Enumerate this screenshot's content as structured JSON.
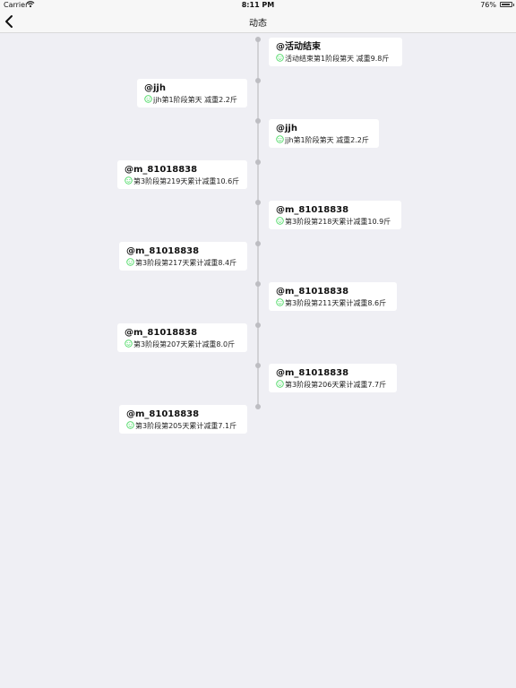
{
  "status_bar": {
    "carrier": "Carrier",
    "time": "8:11 PM",
    "battery": "76%"
  },
  "nav": {
    "title": "动态",
    "back_icon": "chevron-left-icon"
  },
  "accent_color": "#4cd964",
  "feed": [
    {
      "side": "right",
      "name": "@活动结束",
      "detail": "活动结束第1阶段第天 减重9.8斤"
    },
    {
      "side": "left",
      "name": "@jjh",
      "detail": "jjh第1阶段第天 减重2.2斤"
    },
    {
      "side": "right",
      "name": "@jjh",
      "detail": "jjh第1阶段第天 减重2.2斤"
    },
    {
      "side": "left",
      "name": "@m_81018838",
      "detail": "第3阶段第219天累计减重10.6斤"
    },
    {
      "side": "right",
      "name": "@m_81018838",
      "detail": "第3阶段第218天累计减重10.9斤"
    },
    {
      "side": "left",
      "name": "@m_81018838",
      "detail": "第3阶段第217天累计减重8.4斤"
    },
    {
      "side": "right",
      "name": "@m_81018838",
      "detail": "第3阶段第211天累计减重8.6斤"
    },
    {
      "side": "left",
      "name": "@m_81018838",
      "detail": "第3阶段第207天累计减重8.0斤"
    },
    {
      "side": "right",
      "name": "@m_81018838",
      "detail": "第3阶段第206天累计减重7.7斤"
    },
    {
      "side": "left",
      "name": "@m_81018838",
      "detail": "第3阶段第205天累计减重7.1斤"
    }
  ]
}
